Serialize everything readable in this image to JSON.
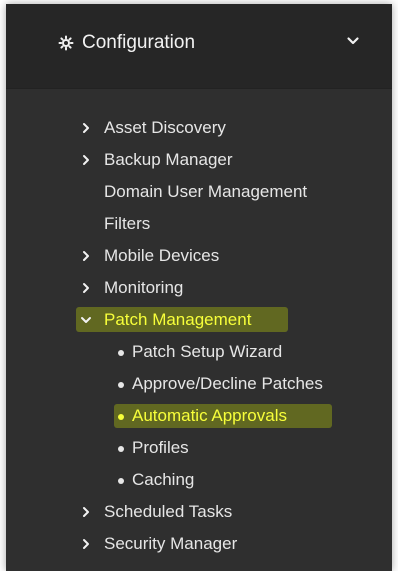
{
  "header": {
    "title": "Configuration",
    "gear_icon": "gear-icon",
    "toggle_icon": "chevron-down-icon"
  },
  "menu": {
    "items": [
      {
        "label": "Asset Discovery",
        "has_caret": true,
        "caret": "chevron-right-icon"
      },
      {
        "label": "Backup Manager",
        "has_caret": true,
        "caret": "chevron-right-icon"
      },
      {
        "label": "Domain User Management",
        "has_caret": false
      },
      {
        "label": "Filters",
        "has_caret": false
      },
      {
        "label": "Mobile Devices",
        "has_caret": true,
        "caret": "chevron-right-icon"
      },
      {
        "label": "Monitoring",
        "has_caret": true,
        "caret": "chevron-right-icon"
      },
      {
        "label": "Patch Management",
        "has_caret": true,
        "caret": "chevron-down-icon",
        "highlighted": true
      },
      {
        "label": "Scheduled Tasks",
        "has_caret": true,
        "caret": "chevron-right-icon"
      },
      {
        "label": "Security Manager",
        "has_caret": true,
        "caret": "chevron-right-icon"
      }
    ],
    "patch_management_children": [
      {
        "label": "Patch Setup Wizard"
      },
      {
        "label": "Approve/Decline Patches"
      },
      {
        "label": "Automatic Approvals",
        "highlighted": true
      },
      {
        "label": "Profiles"
      },
      {
        "label": "Caching"
      }
    ]
  },
  "colors": {
    "panel_bg": "#2f2f2f",
    "header_bg": "#262626",
    "text": "#e6e6e6",
    "highlight_text": "#f7ff3a"
  }
}
